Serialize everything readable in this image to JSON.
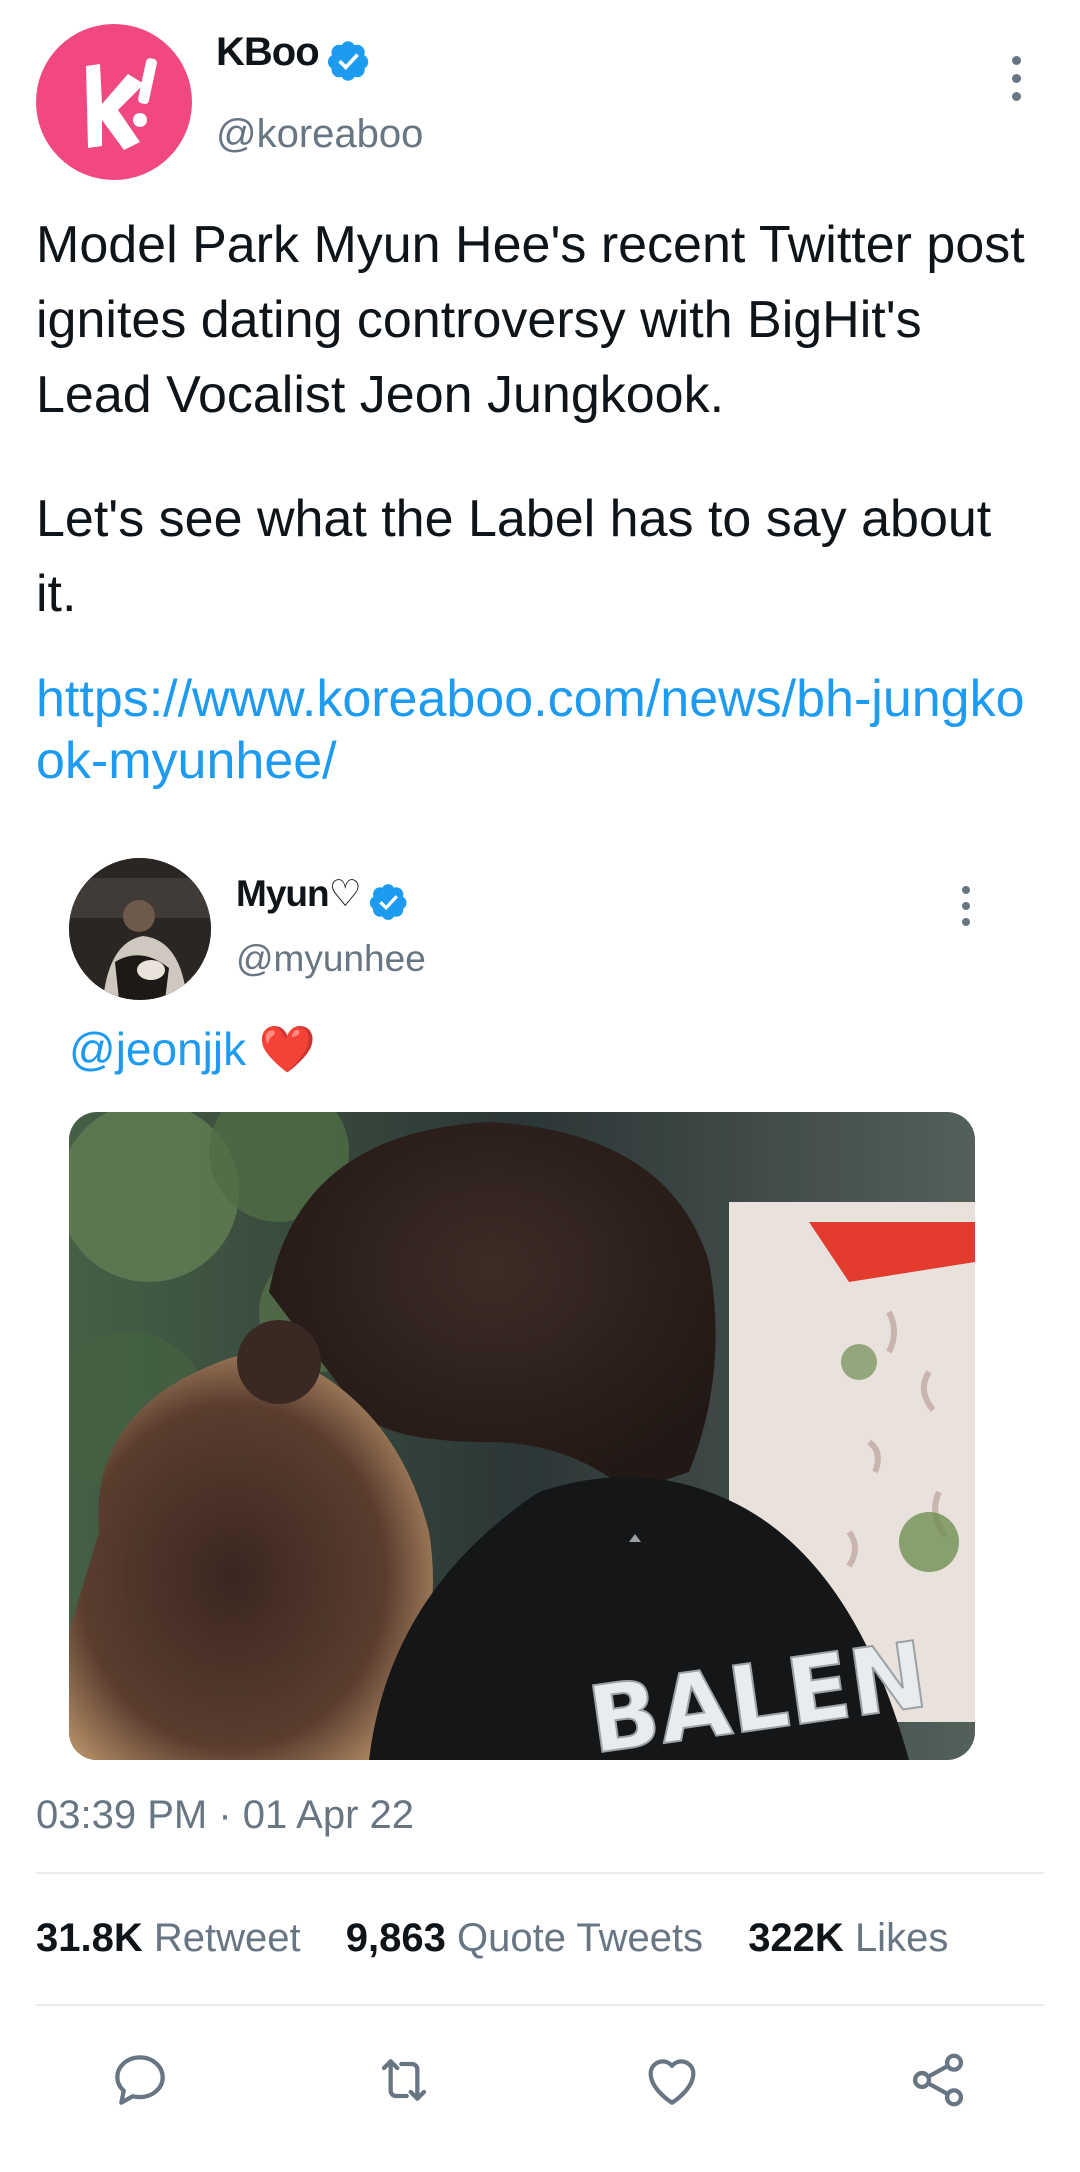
{
  "tweet": {
    "author_name": "KBoo",
    "author_handle": "@koreaboo",
    "paragraph1": "Model Park Myun Hee's recent Twitter post ignites dating controversy with BigHit's Lead Vocalist Jeon Jungkook.",
    "paragraph2": "Let's see what the Label has to say about it.",
    "link": "https://www.koreaboo.com/news/bh-jungkook-myunhee/",
    "timestamp": "03:39 PM · 01 Apr 22"
  },
  "quoted": {
    "author_name": "Myun♡",
    "author_handle": "@myunhee",
    "mention": "@jeonjjk",
    "emoji": "❤️",
    "photo_print": "BALEN"
  },
  "stats": {
    "retweets_count": "31.8K",
    "retweets_label": "Retweet",
    "quotes_count": "9,863",
    "quotes_label": "Quote Tweets",
    "likes_count": "322K",
    "likes_label": "Likes"
  },
  "colors": {
    "brand_pink": "#f0487f",
    "link_blue": "#1d9bf0",
    "secondary_text": "#687684"
  },
  "icons": [
    "verified-badge-icon",
    "more-options-icon",
    "reply-icon",
    "retweet-icon",
    "like-icon",
    "share-icon"
  ]
}
